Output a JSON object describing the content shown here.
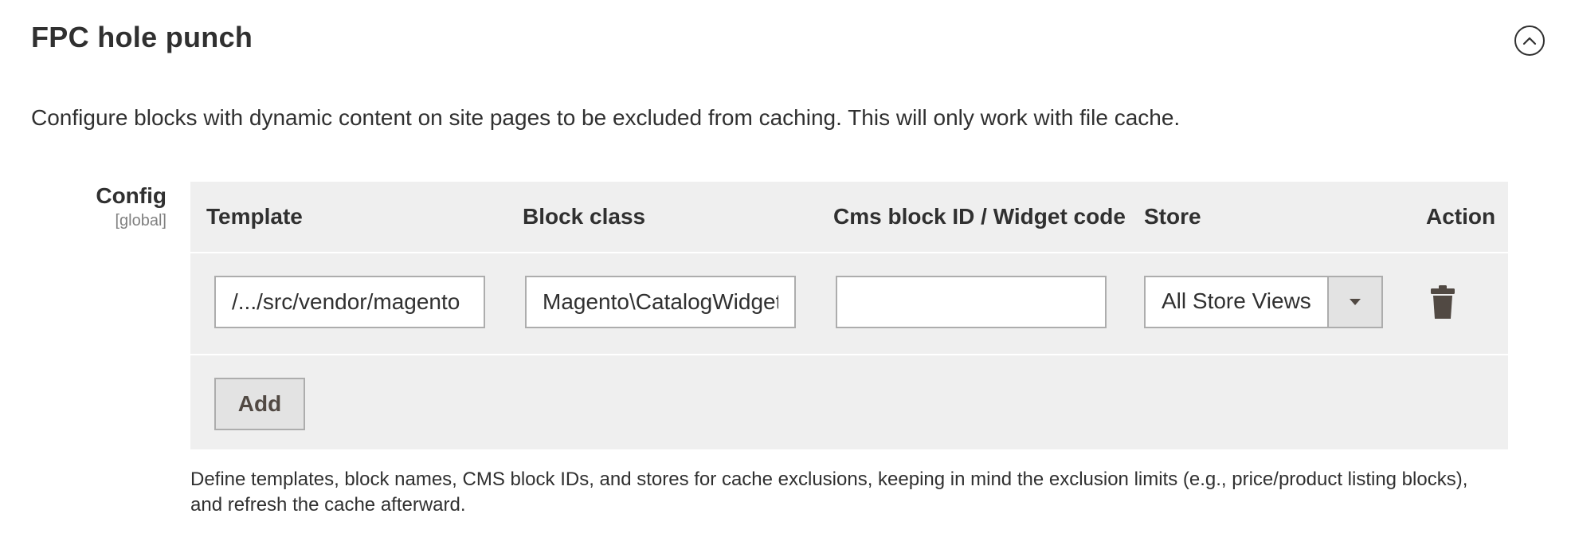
{
  "section": {
    "title": "FPC hole punch",
    "collapse_icon": "chevron-up-circle-icon"
  },
  "description": "Configure blocks with dynamic content on site pages to be excluded from caching. This will only work with file cache.",
  "config_field": {
    "label": "Config",
    "scope": "[global]"
  },
  "grid": {
    "columns": [
      "Template",
      "Block class",
      "Cms block ID / Widget code",
      "Store",
      "Action"
    ],
    "rows": [
      {
        "template": "/.../src/vendor/magento",
        "block_class": "Magento\\CatalogWidget",
        "cms_block_id": "",
        "store": "All Store Views",
        "action_icon": "trash-icon"
      }
    ],
    "add_label": "Add"
  },
  "note": "Define templates, block names, CMS block IDs, and stores for cache exclusions, keeping in mind the exclusion limits (e.g., price/product listing blocks), and refresh the cache afterward.",
  "colors": {
    "text": "#303030",
    "muted": "#808080",
    "grid_bg": "#efefef",
    "border": "#adadad",
    "button_bg": "#e3e3e3"
  }
}
